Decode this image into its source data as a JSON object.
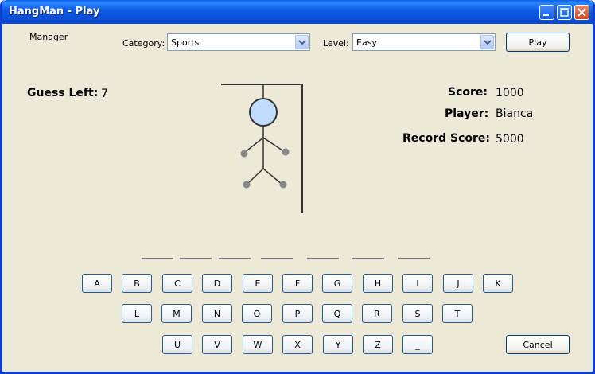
{
  "window": {
    "title": "HangMan - Play"
  },
  "toolbar": {
    "manager_label": "Manager",
    "category_label": "Category:",
    "category_value": "Sports",
    "level_label": "Level:",
    "level_value": "Easy",
    "play_label": "Play"
  },
  "status": {
    "guess_left_label": "Guess Left:",
    "guess_left_value": "7",
    "score_label": "Score:",
    "score_value": "1000",
    "player_label": "Player:",
    "player_value": "Bianca",
    "record_label": "Record Score:",
    "record_value": "5000"
  },
  "word": {
    "blank_count": 7
  },
  "keyboard": {
    "row1": [
      "A",
      "B",
      "C",
      "D",
      "E",
      "F",
      "G",
      "H",
      "I",
      "J",
      "K"
    ],
    "row2": [
      "L",
      "M",
      "N",
      "O",
      "P",
      "Q",
      "R",
      "S",
      "T"
    ],
    "row3": [
      "U",
      "V",
      "W",
      "X",
      "Y",
      "Z",
      "_"
    ]
  },
  "footer": {
    "cancel_label": "Cancel"
  },
  "colors": {
    "titlebar": "#0b4fd4",
    "window_bg": "#ece9d8",
    "head_fill": "#bfdcff",
    "joint": "#888888"
  }
}
